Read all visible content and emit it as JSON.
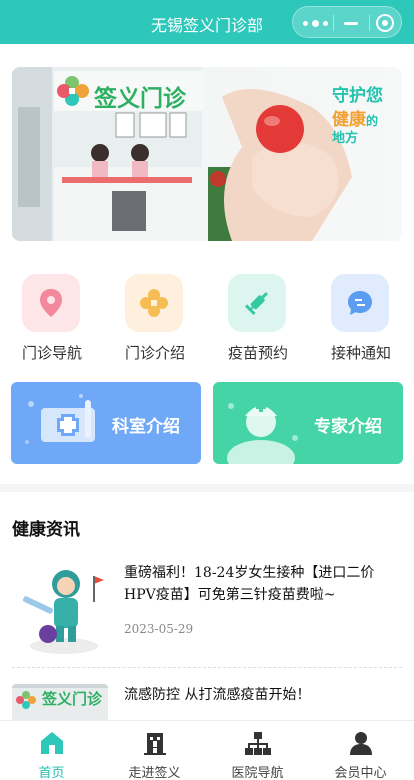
{
  "app": {
    "title": "无锡签义门诊部"
  },
  "banner": {
    "brand_text": "签义门诊",
    "slogan_line1": "守护您",
    "slogan_line2_a": "健康",
    "slogan_line2_b": "的",
    "slogan_line3": "地方"
  },
  "quick_menu": [
    {
      "label": "门诊导航",
      "icon": "location-pin-icon"
    },
    {
      "label": "门诊介绍",
      "icon": "clinic-cross-icon"
    },
    {
      "label": "疫苗预约",
      "icon": "syringe-icon"
    },
    {
      "label": "接种通知",
      "icon": "message-icon"
    }
  ],
  "cards": [
    {
      "label": "科室介绍",
      "color": "#6fa8f6"
    },
    {
      "label": "专家介绍",
      "color": "#45d4a6"
    }
  ],
  "news_section": {
    "title": "健康资讯",
    "items": [
      {
        "title": "重磅福利！18-24岁女生接种【进口二价HPV疫苗】可免第三针疫苗费啦~",
        "date": "2023-05-29"
      },
      {
        "title": "流感防控 从打流感疫苗开始！",
        "date": ""
      }
    ]
  },
  "tabbar": [
    {
      "label": "首页",
      "icon": "home-icon",
      "active": true
    },
    {
      "label": "走进签义",
      "icon": "building-icon",
      "active": false
    },
    {
      "label": "医院导航",
      "icon": "sitemap-icon",
      "active": false
    },
    {
      "label": "会员中心",
      "icon": "user-icon",
      "active": false
    }
  ],
  "colors": {
    "theme": "#2ec8bb",
    "active_tab": "#22bfae"
  }
}
